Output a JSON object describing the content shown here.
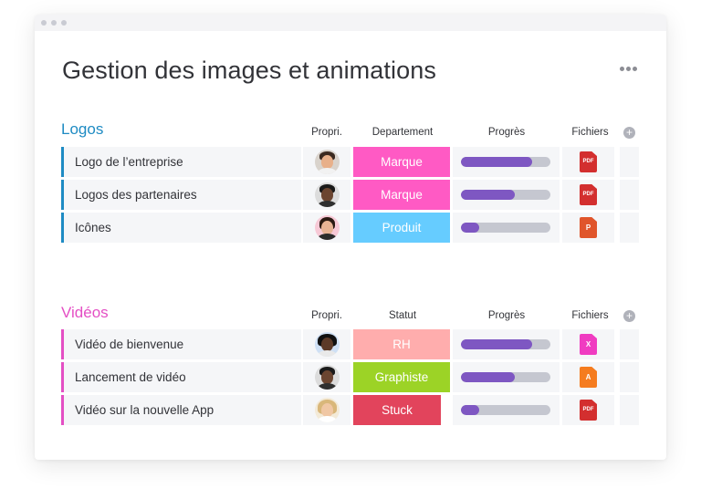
{
  "board": {
    "title": "Gestion des images et animations"
  },
  "groups": [
    {
      "title": "Logos",
      "color": "#1e8bc3",
      "columns": {
        "owner": "Propri.",
        "status": "Departement",
        "progress": "Progrès",
        "files": "Fichiers"
      },
      "rows": [
        {
          "name": "Logo de l’entreprise",
          "status": "Marque",
          "status_color": "#ff5ac4",
          "progress": 0.8,
          "file_type": "PDF",
          "file_color": "#d32f2f"
        },
        {
          "name": "Logos des partenaires",
          "status": "Marque",
          "status_color": "#ff5ac4",
          "progress": 0.6,
          "file_type": "PDF",
          "file_color": "#d32f2f"
        },
        {
          "name": "Icônes",
          "status": "Produit",
          "status_color": "#66ccff",
          "progress": 0.2,
          "file_type": "P",
          "file_color": "#e0552b"
        }
      ]
    },
    {
      "title": "Vidéos",
      "color": "#e44fc4",
      "columns": {
        "owner": "Propri.",
        "status": "Statut",
        "progress": "Progrès",
        "files": "Fichiers"
      },
      "rows": [
        {
          "name": "Vidéo de bienvenue",
          "status": "RH",
          "status_color": "#ffadad",
          "progress": 0.8,
          "file_type": "X",
          "file_color": "#f03cc1"
        },
        {
          "name": "Lancement de vidéo",
          "status": "Graphiste",
          "status_color": "#9cd326",
          "progress": 0.6,
          "file_type": "A",
          "file_color": "#f57c1f"
        },
        {
          "name": "Vidéo sur la nouvelle App",
          "status": "Stuck",
          "status_color": "#e2445c",
          "progress": 0.2,
          "file_type": "PDF",
          "file_color": "#d32f2f"
        }
      ]
    }
  ]
}
